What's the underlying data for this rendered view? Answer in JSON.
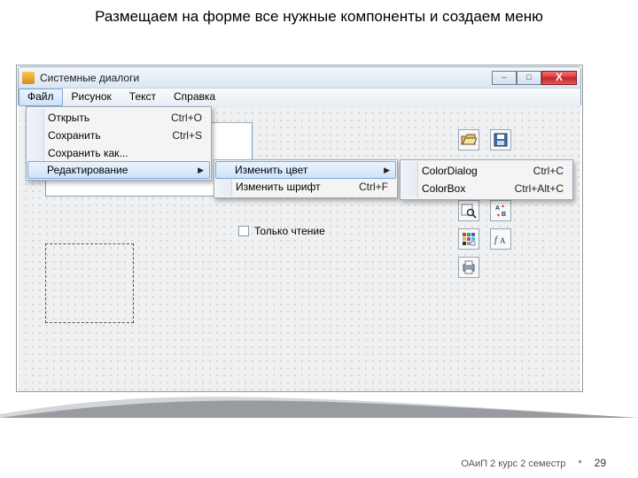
{
  "slide": {
    "title": "Размещаем на форме все нужные компоненты и создаем меню",
    "footer_text": "ОАиП 2 курс 2 семестр",
    "footer_mark": "*",
    "page_number": "29"
  },
  "window": {
    "title": "Системные диалоги",
    "buttons": {
      "min": "–",
      "max": "□",
      "close": "X"
    }
  },
  "menubar": {
    "file": "Файл",
    "picture": "Рисунок",
    "text": "Текст",
    "help": "Справка"
  },
  "file_menu": {
    "open": {
      "label": "Открыть",
      "shortcut": "Ctrl+O"
    },
    "save": {
      "label": "Сохранить",
      "shortcut": "Ctrl+S"
    },
    "save_as": {
      "label": "Сохранить как..."
    },
    "editing": {
      "label": "Редактирование"
    }
  },
  "edit_menu": {
    "change_color": {
      "label": "Изменить цвет"
    },
    "change_font": {
      "label": "Изменить шрифт",
      "shortcut": "Ctrl+F"
    }
  },
  "color_menu": {
    "color_dialog": {
      "label": "ColorDialog",
      "shortcut": "Ctrl+C"
    },
    "color_box": {
      "label": "ColorBox",
      "shortcut": "Ctrl+Alt+C"
    }
  },
  "form": {
    "readonly_label": "Только чтение"
  },
  "components": {
    "open_dialog": "open-dialog-icon",
    "save_dialog": "save-dialog-icon",
    "find_dialog": "find-dialog-icon",
    "replace_dialog": "replace-dialog-icon",
    "color_dialog": "color-dialog-icon",
    "font_dialog": "font-dialog-icon",
    "print_dialog": "print-dialog-icon"
  }
}
